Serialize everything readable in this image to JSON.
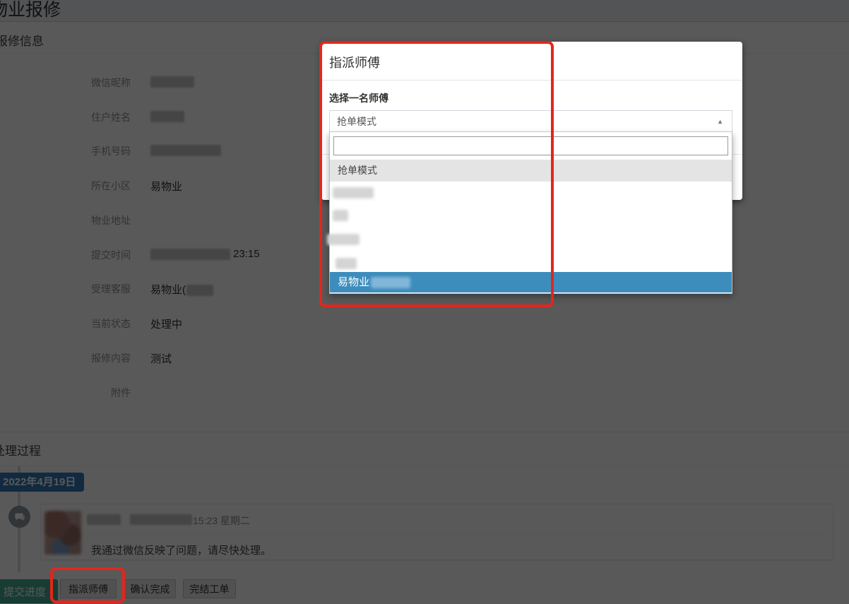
{
  "page": {
    "title": "物业报修"
  },
  "repair_info": {
    "header": "报修信息",
    "fields": [
      {
        "label": "微信昵称",
        "value": ""
      },
      {
        "label": "住户姓名",
        "value": ""
      },
      {
        "label": "手机号码",
        "value": ""
      },
      {
        "label": "所在小区",
        "value": "易物业"
      },
      {
        "label": "物业地址",
        "value": ""
      },
      {
        "label": "提交时间",
        "value": "23:15"
      },
      {
        "label": "受理客服",
        "value": "易物业("
      },
      {
        "label": "当前状态",
        "value": "处理中"
      },
      {
        "label": "报修内容",
        "value": "测试"
      },
      {
        "label": "附件",
        "value": ""
      }
    ]
  },
  "process": {
    "header": "处理过程",
    "date_badge": "2022年4月19日",
    "comment": {
      "time": "15:23 星期二",
      "message": "我通过微信反映了问题，请尽快处理。"
    }
  },
  "actions": {
    "submit_progress": "提交进度",
    "assign_master": "指派师傅",
    "confirm_done": "确认完成",
    "close_ticket": "完结工单"
  },
  "modal": {
    "title": "指派师傅",
    "field_label": "选择一名师傅",
    "select_value": "抢单模式",
    "search_placeholder": "",
    "options": [
      {
        "label": "抢单模式",
        "state": "hover"
      },
      {
        "label": "",
        "state": "redacted"
      },
      {
        "label": "",
        "state": "redacted"
      },
      {
        "label": "",
        "state": "redacted"
      },
      {
        "label": "",
        "state": "redacted"
      },
      {
        "label": "易物业",
        "state": "selected-redacted-suffix"
      }
    ]
  },
  "colors": {
    "selected_option_bg": "#3c8dbc",
    "hover_option_bg": "#e4e4e4",
    "date_badge_bg": "#337ab7",
    "primary_button_bg": "#45ab93",
    "annotation": "#e3261d",
    "backdrop": "rgba(0,0,0,0.65)"
  }
}
